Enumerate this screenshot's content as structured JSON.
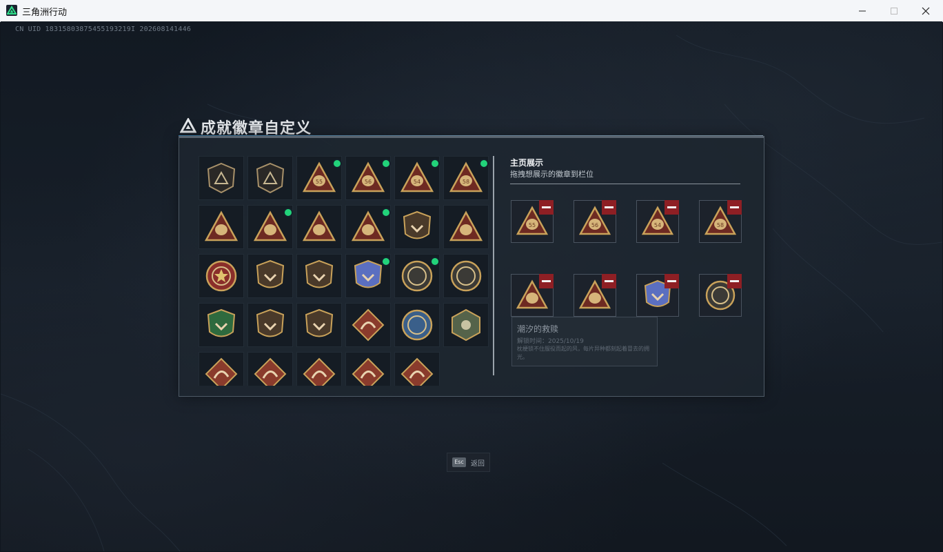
{
  "window": {
    "title": "三角洲行动",
    "buttons": [
      "minimize",
      "maximize",
      "close"
    ]
  },
  "uid_text": "CN UID 18315803875455193219I 202608141446",
  "panel": {
    "title": "成就徽章自定义",
    "section_title": "主页展示",
    "section_subtitle": "拖拽想展示的徽章到栏位"
  },
  "badges": [
    {
      "icon": "shield-triangle-emblem-icon",
      "new": false
    },
    {
      "icon": "helicopter-emblem-icon",
      "new": false
    },
    {
      "icon": "money-bag-55-icon",
      "new": true
    },
    {
      "icon": "helmet-56-icon",
      "new": true
    },
    {
      "icon": "radio-54-icon",
      "new": true
    },
    {
      "icon": "card-58-icon",
      "new": true
    },
    {
      "icon": "soldier-bust-icon",
      "new": false
    },
    {
      "icon": "helmet-emblem-icon",
      "new": true
    },
    {
      "icon": "number-one-triangle-icon",
      "new": false
    },
    {
      "icon": "crouching-soldier-icon",
      "new": true
    },
    {
      "icon": "shield-crest-icon",
      "new": false
    },
    {
      "icon": "squad-triangle-icon",
      "new": false
    },
    {
      "icon": "star-medal-icon",
      "new": false
    },
    {
      "icon": "chevron-shield-icon",
      "new": false
    },
    {
      "icon": "medal-crest-icon",
      "new": false
    },
    {
      "icon": "blue-shield-icon",
      "new": true
    },
    {
      "icon": "round-helmet-medal-icon",
      "new": true
    },
    {
      "icon": "sniper-medal-icon",
      "new": false
    },
    {
      "icon": "green-rifle-shield-icon",
      "new": false
    },
    {
      "icon": "pistol-shield-icon",
      "new": false
    },
    {
      "icon": "winged-crest-icon",
      "new": false
    },
    {
      "icon": "wolf-diamond-icon",
      "new": false
    },
    {
      "icon": "eagle-medal-icon",
      "new": false
    },
    {
      "icon": "hexagon-insect-icon",
      "new": false
    },
    {
      "icon": "dragon-diamond-icon",
      "new": false
    },
    {
      "icon": "dragon-diamond-2-icon",
      "new": false
    },
    {
      "icon": "runner-diamond-icon",
      "new": false
    },
    {
      "icon": "horse-diamond-icon",
      "new": false
    },
    {
      "icon": "blade-diamond-icon",
      "new": false
    }
  ],
  "showcase": [
    {
      "icon": "money-bag-55-icon",
      "label": "55"
    },
    {
      "icon": "helmet-56-icon",
      "label": "56"
    },
    {
      "icon": "radio-54-icon",
      "label": "54"
    },
    {
      "icon": "card-58-icon",
      "label": "58"
    },
    {
      "icon": "crouching-soldier-icon",
      "label": ""
    },
    {
      "icon": "helmet-emblem-icon",
      "label": ""
    },
    {
      "icon": "blue-shield-icon",
      "label": ""
    },
    {
      "icon": "round-helmet-medal-icon",
      "label": ""
    }
  ],
  "tooltip": {
    "name": "潮汐的救赎",
    "date": "解锁时间：2025/10/19",
    "description": "枕梗锁不住服役而起的风，每片异种都刻起着冒去的拥光。"
  },
  "esc": {
    "key": "Esc",
    "label": "返回"
  },
  "colors": {
    "new_dot": "#22d37a",
    "remove": "#8e1f24",
    "gold": "#c9a25a",
    "maroon": "#6e2a22"
  }
}
